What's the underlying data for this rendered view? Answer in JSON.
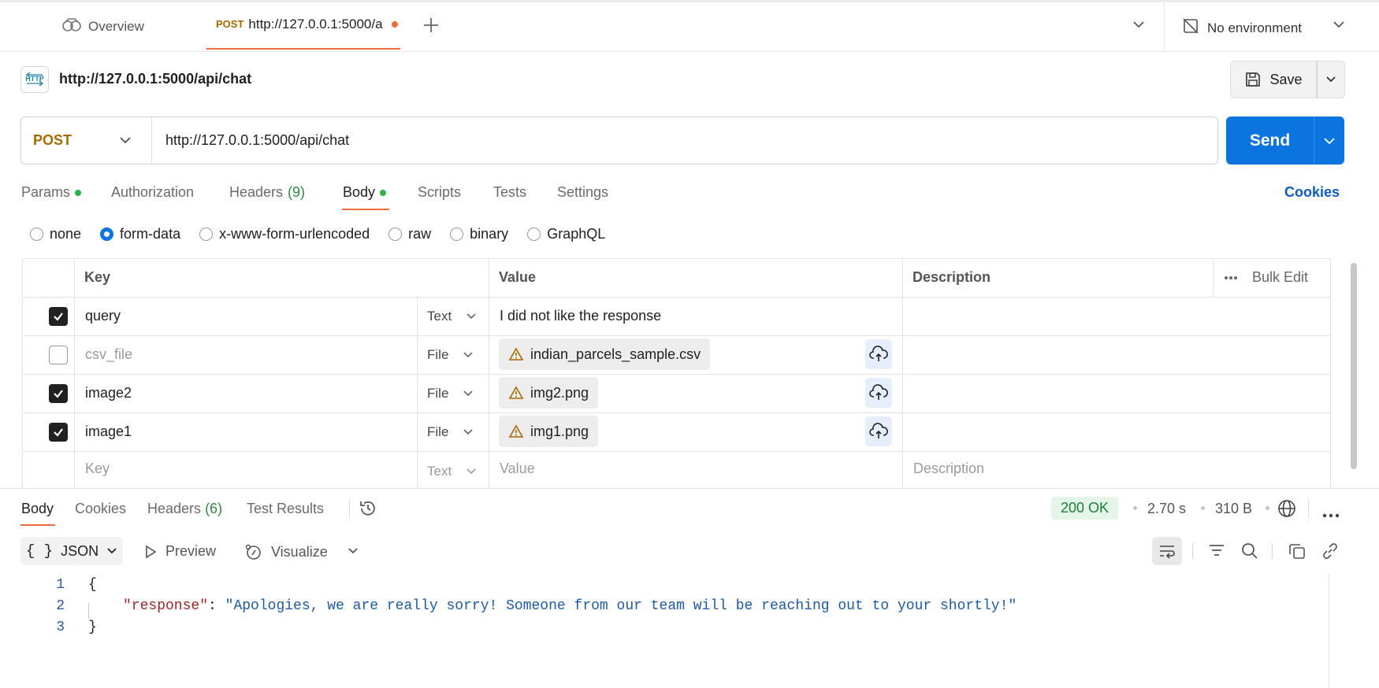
{
  "tabs": {
    "overview_label": "Overview",
    "active_method": "POST",
    "active_url": "http://127.0.0.1:5000/a",
    "environment": "No environment"
  },
  "request": {
    "title": "http://127.0.0.1:5000/api/chat",
    "save_label": "Save",
    "method": "POST",
    "url": "http://127.0.0.1:5000/api/chat",
    "send_label": "Send"
  },
  "request_tabs": {
    "params": "Params",
    "authorization": "Authorization",
    "headers": "Headers",
    "headers_count": "(9)",
    "body": "Body",
    "scripts": "Scripts",
    "tests": "Tests",
    "settings": "Settings",
    "cookies": "Cookies"
  },
  "body_types": [
    "none",
    "form-data",
    "x-www-form-urlencoded",
    "raw",
    "binary",
    "GraphQL"
  ],
  "form_table": {
    "headers": {
      "key": "Key",
      "value": "Value",
      "description": "Description",
      "bulk_edit": "Bulk Edit"
    },
    "rows": [
      {
        "checked": true,
        "key": "query",
        "type": "Text",
        "value": "I did not like the response"
      },
      {
        "checked": false,
        "key": "csv_file",
        "type": "File",
        "value": "indian_parcels_sample.csv"
      },
      {
        "checked": true,
        "key": "image2",
        "type": "File",
        "value": "img2.png"
      },
      {
        "checked": true,
        "key": "image1",
        "type": "File",
        "value": "img1.png"
      }
    ],
    "placeholder": {
      "key": "Key",
      "type": "Text",
      "value": "Value",
      "description": "Description"
    }
  },
  "response": {
    "tabs": {
      "body": "Body",
      "cookies": "Cookies",
      "headers": "Headers",
      "headers_count": "(6)",
      "test_results": "Test Results"
    },
    "status": "200 OK",
    "time": "2.70 s",
    "size": "310 B",
    "format": "JSON",
    "preview": "Preview",
    "visualize": "Visualize",
    "code": {
      "line_numbers": [
        "1",
        "2",
        "3"
      ],
      "open": "{",
      "key": "\"response\"",
      "colon": ": ",
      "value": "\"Apologies, we are really sorry! Someone from our team will be reaching out to your shortly!\"",
      "close": "}"
    }
  },
  "colors": {
    "accent_orange": "#f26b3a",
    "send_blue": "#0b74de",
    "method_post": "#a86a00",
    "status_green": "#1e7d36"
  }
}
